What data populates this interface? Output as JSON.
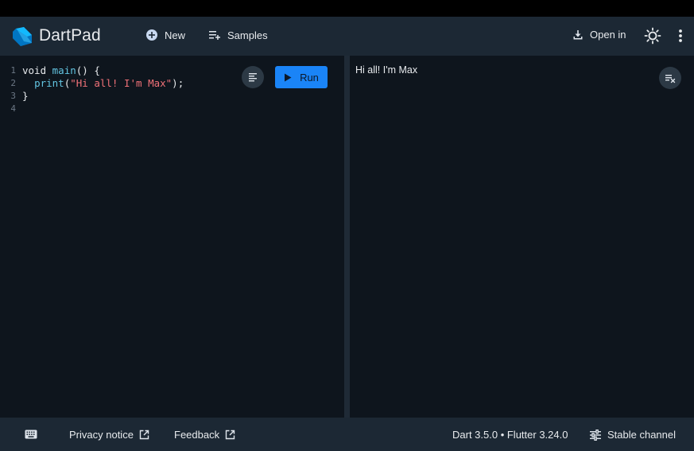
{
  "app": {
    "title": "DartPad"
  },
  "header": {
    "new_label": "New",
    "samples_label": "Samples",
    "open_in_label": "Open in"
  },
  "editor": {
    "run_label": "Run",
    "lines": [
      {
        "num": "1",
        "tokens": [
          {
            "t": "kw",
            "text": "void "
          },
          {
            "t": "fn",
            "text": "main"
          },
          {
            "t": "plain",
            "text": "() {"
          }
        ]
      },
      {
        "num": "2",
        "tokens": [
          {
            "t": "plain",
            "text": "  "
          },
          {
            "t": "fn",
            "text": "print"
          },
          {
            "t": "plain",
            "text": "("
          },
          {
            "t": "str",
            "text": "\"Hi all! I'm Max\""
          },
          {
            "t": "plain",
            "text": ");"
          }
        ]
      },
      {
        "num": "3",
        "tokens": [
          {
            "t": "plain",
            "text": "}"
          }
        ]
      },
      {
        "num": "4",
        "tokens": []
      }
    ]
  },
  "output": {
    "text": "Hi all! I'm Max"
  },
  "footer": {
    "privacy_label": "Privacy notice",
    "feedback_label": "Feedback",
    "version_text": "Dart 3.5.0 • Flutter 3.24.0",
    "channel_label": "Stable channel"
  },
  "colors": {
    "accent": "#1a84f7",
    "header_bg": "#1c2834",
    "panel_bg": "#0e151d",
    "function": "#63c5e2",
    "string": "#f07178"
  },
  "icons": {
    "logo": "dart-logo-icon",
    "new": "add-circle-icon",
    "samples": "playlist-add-icon",
    "open_in": "download-icon",
    "theme": "brightness-icon",
    "more": "more-vert-icon",
    "format": "format-align-icon",
    "run": "play-icon",
    "clear": "clear-all-icon",
    "keyboard": "keyboard-icon",
    "external": "open-in-new-icon",
    "channel": "tune-icon"
  }
}
